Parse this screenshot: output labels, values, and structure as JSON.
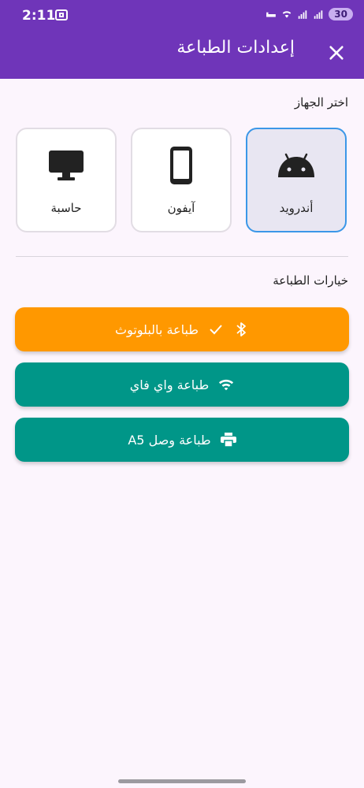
{
  "status_bar": {
    "time": "2:11",
    "battery": "30"
  },
  "app_bar": {
    "title": "إعدادات الطباعة",
    "close_icon": "close-icon"
  },
  "device_section": {
    "label": "اختر الجهاز",
    "devices": [
      {
        "label": "أندرويد",
        "icon": "android-icon",
        "selected": true
      },
      {
        "label": "آيفون",
        "icon": "phone-icon",
        "selected": false
      },
      {
        "label": "حاسبة",
        "icon": "monitor-icon",
        "selected": false
      }
    ]
  },
  "print_section": {
    "label": "خيارات الطباعة",
    "buttons": [
      {
        "label": "طباعة بالبلوتوث",
        "icon": "bluetooth-icon",
        "check_icon": "check-icon",
        "color": "#ff9800",
        "active": true
      },
      {
        "label": "طباعة واي فاي",
        "icon": "wifi-icon",
        "color": "#009688",
        "active": false
      },
      {
        "label": "طباعة وصل A5",
        "icon": "printer-icon",
        "color": "#009688",
        "active": false
      }
    ]
  },
  "colors": {
    "primary": "#6f35b9",
    "selected_border": "#3b97e8",
    "bluetooth_button": "#ff9800",
    "teal_button": "#009688"
  }
}
